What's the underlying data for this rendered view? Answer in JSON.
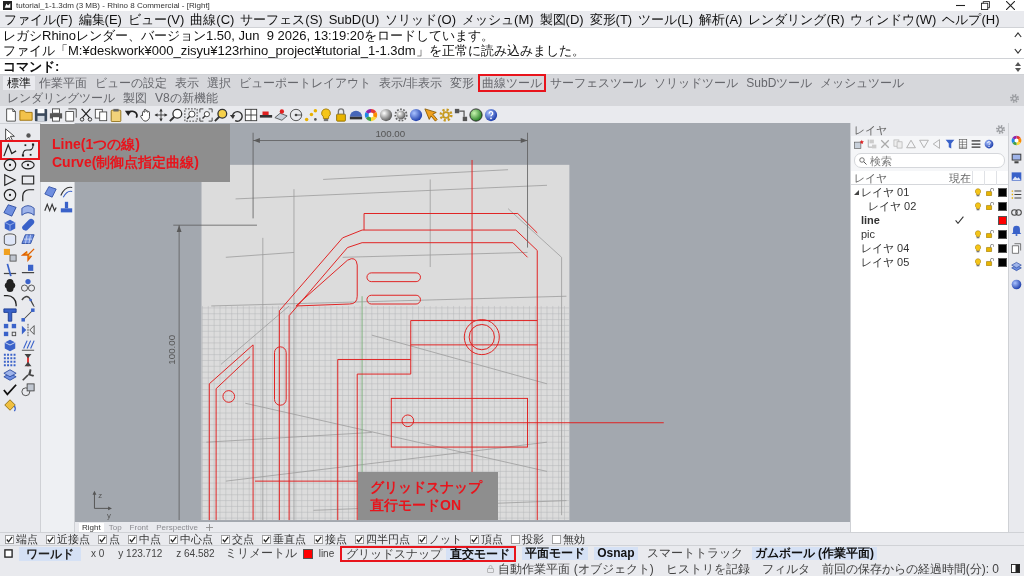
{
  "window": {
    "title": "tutorial_1-1.3dm (3 MB) - Rhino 8 Commercial - [Right]"
  },
  "menu": [
    "ファイル(F)",
    "編集(E)",
    "ビュー(V)",
    "曲線(C)",
    "サーフェス(S)",
    "SubD(U)",
    "ソリッド(O)",
    "メッシュ(M)",
    "製図(D)",
    "変形(T)",
    "ツール(L)",
    "解析(A)",
    "レンダリング(R)",
    "ウィンドウ(W)",
    "ヘルプ(H)"
  ],
  "command_history": [
    "レガシRhinoレンダー、バージョン1.50, Jun  9 2026, 13:19:20をロードしています。",
    "ファイル「M:¥deskwork¥000_zisyu¥123rhino_project¥tutorial_1-1.3dm」を正常に読み込みました。"
  ],
  "command_prompt": "コマンド:",
  "toolbar_tabs": [
    {
      "label": "標準",
      "selected": true,
      "highlighted": false
    },
    {
      "label": "作業平面",
      "selected": false,
      "highlighted": false
    },
    {
      "label": "ビューの設定",
      "selected": false,
      "highlighted": false
    },
    {
      "label": "表示",
      "selected": false,
      "highlighted": false
    },
    {
      "label": "選択",
      "selected": false,
      "highlighted": false
    },
    {
      "label": "ビューポートレイアウト",
      "selected": false,
      "highlighted": false
    },
    {
      "label": "表示/非表示",
      "selected": false,
      "highlighted": false
    },
    {
      "label": "変形",
      "selected": false,
      "highlighted": false
    },
    {
      "label": "曲線ツール",
      "selected": false,
      "highlighted": true
    },
    {
      "label": "サーフェスツール",
      "selected": false,
      "highlighted": false
    },
    {
      "label": "ソリッドツール",
      "selected": false,
      "highlighted": false
    },
    {
      "label": "SubDツール",
      "selected": false,
      "highlighted": false
    },
    {
      "label": "メッシュツール",
      "selected": false,
      "highlighted": false
    },
    {
      "label": "レンダリングツール",
      "selected": false,
      "highlighted": false
    },
    {
      "label": "製図",
      "selected": false,
      "highlighted": false
    },
    {
      "label": "V8の新機能",
      "selected": false,
      "highlighted": false
    }
  ],
  "viewport": {
    "horizontal_dimension": "100.00",
    "vertical_dimension": "100.00",
    "axis_labels": [
      "z",
      "y"
    ]
  },
  "viewport_tabs": [
    {
      "label": "Right",
      "selected": true
    },
    {
      "label": "Top",
      "selected": false
    },
    {
      "label": "Front",
      "selected": false
    },
    {
      "label": "Perspective",
      "selected": false
    }
  ],
  "layers_panel": {
    "title": "レイヤ",
    "search": {
      "placeholder": "検索"
    },
    "columns": [
      "レイヤ",
      "現在"
    ],
    "layers": [
      {
        "name": "レイヤ 01",
        "expanded": true,
        "current": false,
        "visible": true,
        "locked": false,
        "color": "#000000",
        "children": [
          {
            "name": "レイヤ 02",
            "current": false,
            "visible": true,
            "locked": false,
            "color": "#000000"
          }
        ]
      },
      {
        "name": "line",
        "current": true,
        "color": "#ff0000"
      },
      {
        "name": "pic",
        "current": false,
        "visible": true,
        "locked": false,
        "color": "#000000"
      },
      {
        "name": "レイヤ 04",
        "current": false,
        "visible": true,
        "locked": false,
        "color": "#000000"
      },
      {
        "name": "レイヤ 05",
        "current": false,
        "visible": true,
        "locked": false,
        "color": "#000000"
      }
    ]
  },
  "osnaps": [
    {
      "label": "端点",
      "checked": true
    },
    {
      "label": "近接点",
      "checked": true
    },
    {
      "label": "点",
      "checked": true
    },
    {
      "label": "中点",
      "checked": true
    },
    {
      "label": "中心点",
      "checked": true
    },
    {
      "label": "交点",
      "checked": true
    },
    {
      "label": "垂直点",
      "checked": true
    },
    {
      "label": "接点",
      "checked": true
    },
    {
      "label": "四半円点",
      "checked": true
    },
    {
      "label": "ノット",
      "checked": true
    },
    {
      "label": "頂点",
      "checked": true
    },
    {
      "label": "投影",
      "checked": false
    },
    {
      "label": "無効",
      "checked": false
    }
  ],
  "status_bar": {
    "cplane": "ワールド",
    "coordinates": [
      "x 0",
      "y 123.712",
      "z 64.582"
    ],
    "units": "ミリメートル",
    "layer": {
      "name": "line",
      "color": "#ff0000"
    },
    "toggles": [
      {
        "label": "グリッドスナップ",
        "on": false,
        "highlighted": true
      },
      {
        "label": "直交モード",
        "on": true,
        "highlighted": true
      },
      {
        "label": "平面モード",
        "on": true,
        "highlighted": false
      },
      {
        "label": "Osnap",
        "on": true,
        "highlighted": false
      },
      {
        "label": "スマートトラック",
        "on": false,
        "highlighted": false
      },
      {
        "label": "ガムボール (作業平面)",
        "on": true,
        "highlighted": false
      }
    ],
    "options": [
      "自動作業平面 (オブジェクト)",
      "ヒストリを記録",
      "フィルタ"
    ],
    "save_timer": "前回の保存からの経過時間(分): 0"
  },
  "annotations": [
    {
      "lines": [
        "Line(1つの線)",
        "Curve(制御点指定曲線)"
      ]
    },
    {
      "lines": [
        "グリッドスナップ",
        "直行モードON"
      ]
    }
  ]
}
